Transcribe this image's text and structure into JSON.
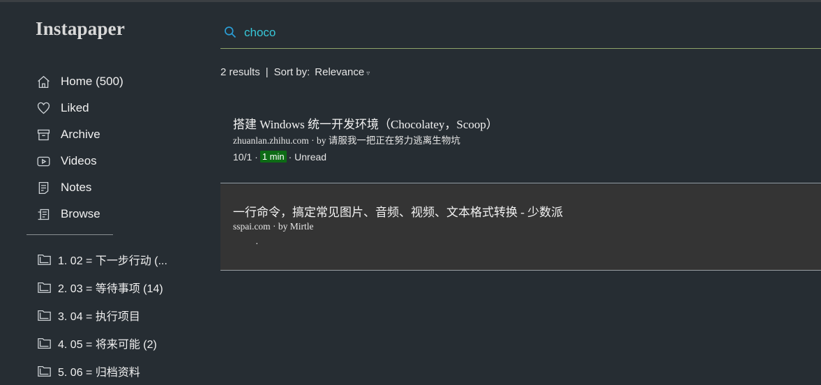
{
  "app": {
    "logo": "Instapaper"
  },
  "sidebar": {
    "nav": [
      {
        "label": "Home (500)",
        "icon": "home-icon"
      },
      {
        "label": "Liked",
        "icon": "heart-icon"
      },
      {
        "label": "Archive",
        "icon": "archive-icon"
      },
      {
        "label": "Videos",
        "icon": "video-icon"
      },
      {
        "label": "Notes",
        "icon": "notes-icon"
      },
      {
        "label": "Browse",
        "icon": "browse-icon"
      }
    ],
    "folders": [
      {
        "label": "1. 02 = 下一步行动 (..."
      },
      {
        "label": "2. 03 = 等待事项 (14)"
      },
      {
        "label": "3. 04 = 执行项目"
      },
      {
        "label": "4. 05 = 将来可能 (2)"
      },
      {
        "label": "5. 06 = 归档资料"
      }
    ]
  },
  "search": {
    "value": "choco",
    "accent": "#37c7d8",
    "icon": "search-icon"
  },
  "results": {
    "count_text": "2 results",
    "separator": "|",
    "sort_label": "Sort by:",
    "sort_value": "Relevance",
    "sort_caret": "▿"
  },
  "articles": [
    {
      "title": "搭建 Windows 统一开发环境（Chocolatey，Scoop）",
      "meta": "zhuanlan.zhihu.com  · by 请服我一把正在努力逃离生物坑",
      "date": "10/1 ·",
      "read_time": "1 min",
      "status": "· Unread"
    },
    {
      "title": "一行命令，搞定常见图片、音频、视频、文本格式转换 - 少数派",
      "meta": "sspai.com · by Mirtle",
      "dot": "·"
    }
  ],
  "colors": {
    "background": "#262d33",
    "badge": "#0d6b15",
    "selected_row": "#343434"
  }
}
